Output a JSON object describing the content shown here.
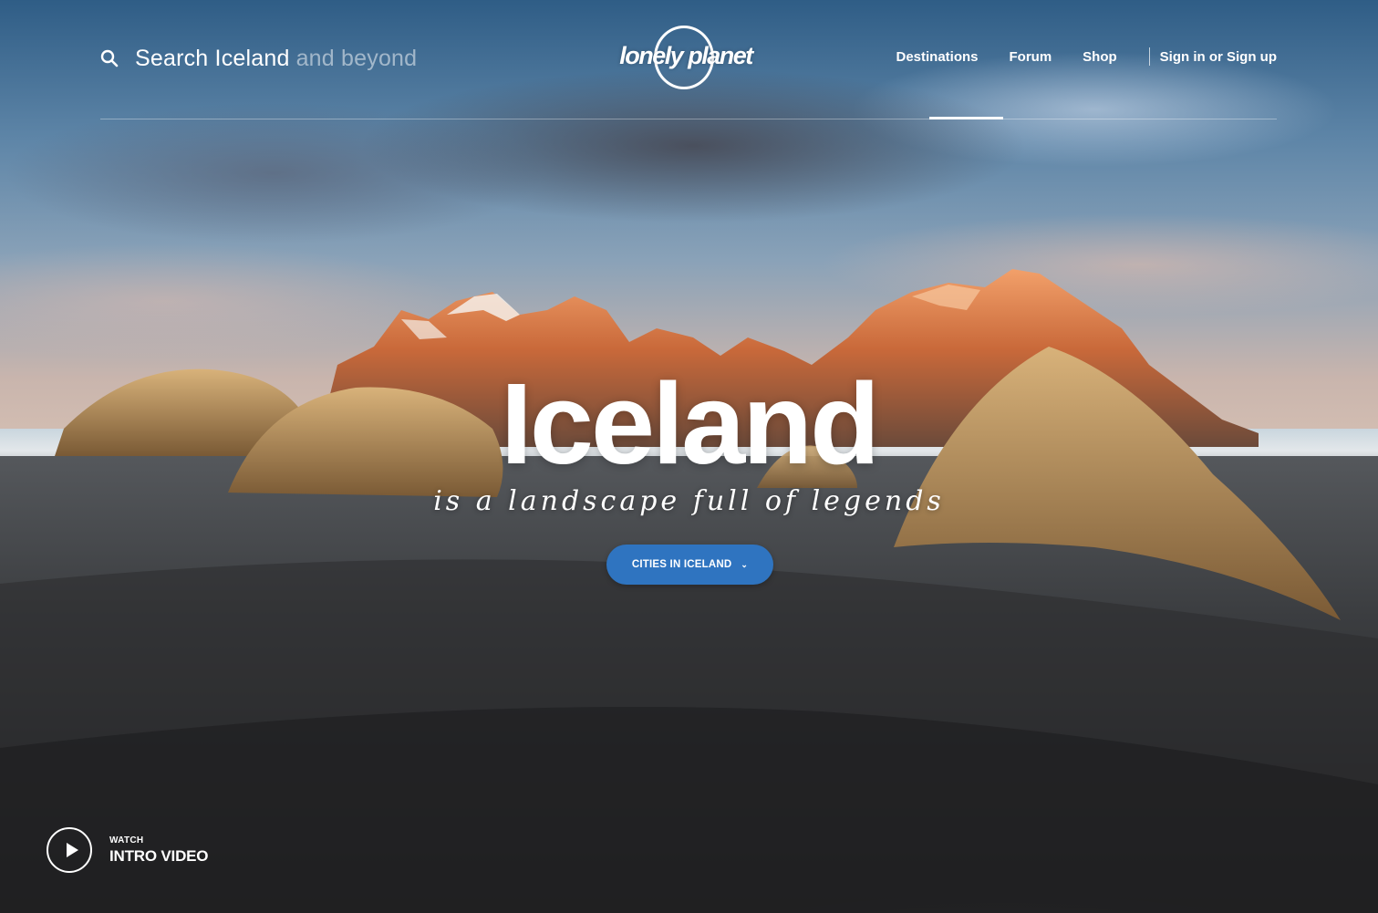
{
  "search": {
    "text_main": "Search Iceland",
    "text_dim": "and beyond",
    "icon": "search-icon"
  },
  "logo": {
    "text": "lonely planet"
  },
  "nav": {
    "items": [
      {
        "label": "Destinations",
        "active": true
      },
      {
        "label": "Forum",
        "active": false
      },
      {
        "label": "Shop",
        "active": false
      }
    ],
    "signin": "Sign in or Sign up"
  },
  "hero": {
    "title": "Iceland",
    "tagline": "is a landscape full of legends",
    "button_label": "CITIES IN ICELAND",
    "button_icon": "chevron-down-icon"
  },
  "video": {
    "small": "WATCH",
    "big": "INTRO VIDEO",
    "icon": "play-icon"
  },
  "colors": {
    "button": "#2f74c0",
    "text": "#ffffff"
  }
}
